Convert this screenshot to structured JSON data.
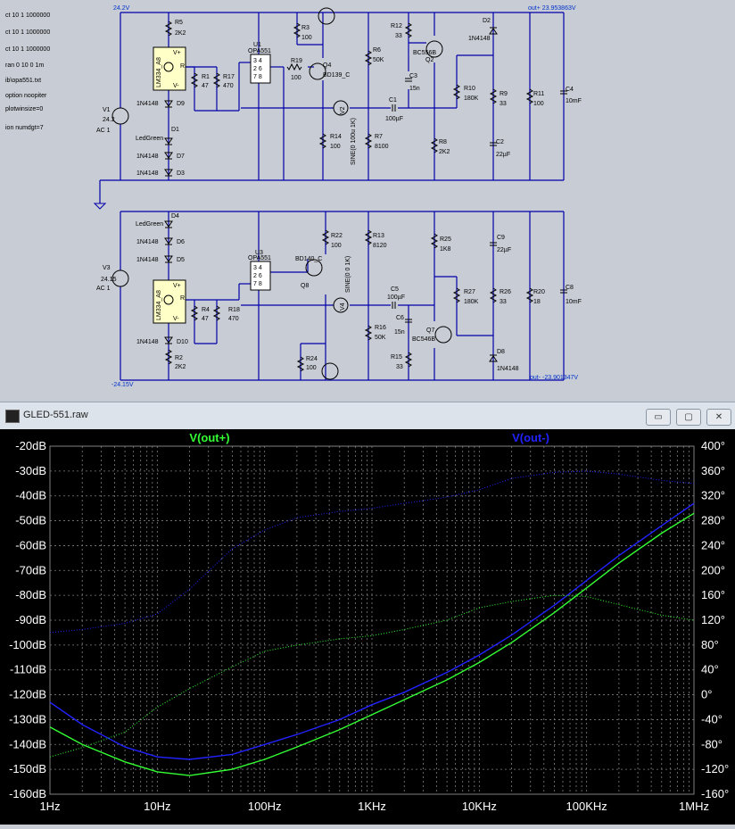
{
  "schematic": {
    "directives": [
      "ct 10 1 1000000",
      "ct 10 1 1000000",
      "ct 10 1 1000000",
      "ran 0 10 0 1m",
      "ib\\opa551.txt",
      "option noopiter",
      "plotwinsize=0",
      "ion numdgt=7"
    ],
    "net_top_left": "24.2V",
    "net_top_right": "out+ 23.953863V",
    "net_bottom_left": "-24.15V",
    "net_bottom_right": "out- -23.901347V",
    "parts": {
      "r5": "R5",
      "r5v": "2K2",
      "u_top": "LM334_A8",
      "vplus": "V+",
      "vminus": "V-",
      "rpin": "R",
      "r1": "R1",
      "r1v": "47",
      "r17": "R17",
      "r17v": "470",
      "d9": "D9",
      "dtype": "1N4148",
      "d1": "D1",
      "ledgreen": "LedGreen",
      "d7": "D7",
      "d3": "D3",
      "v1": "V1",
      "v1v": "24.2",
      "ac1": "AC 1",
      "u1": "U1",
      "opa": "OPA551",
      "pins1": "3 4",
      "pins2": "2 6",
      "pins3": "7 8",
      "r3": "R3",
      "r3v": "100",
      "r19": "R19",
      "r19v": "100",
      "q4": "Q4",
      "q4t": "BD139_C",
      "r6": "R6",
      "r6v": "50K",
      "r12": "R12",
      "r12v": "33",
      "c3": "C3",
      "c3v": "15n",
      "q2t": "BC556B",
      "q2": "Q2",
      "d2": "D2",
      "v2": "V2",
      "c1": "C1",
      "c1v": "100µF",
      "r14": "R14",
      "r14v": "100",
      "sine_top": "SINE(0 100u 1K)",
      "r7": "R7",
      "r7v": "8100",
      "r10": "R10",
      "r10v": "180K",
      "r8": "R8",
      "r8v": "2K2",
      "r9": "R9",
      "r9v": "33",
      "r11": "R11",
      "r11v": "100",
      "c2": "C2",
      "c2v": "22µF",
      "c4": "C4",
      "c4v": "10mF",
      "d4": "D4",
      "d6": "D6",
      "d5": "D5",
      "v3": "V3",
      "v3v": "24.15",
      "u3": "U3",
      "r22": "R22",
      "r22v": "100",
      "q8t": "BD140_C",
      "q8": "Q8",
      "r13": "R13",
      "r13v": "8120",
      "r25": "R25",
      "r25v": "1K8",
      "c9": "C9",
      "c9v": "22µF",
      "sine_bot": "SINE(0 0 1K)",
      "c5": "C5",
      "c5v": "100µF",
      "r27": "R27",
      "r27v": "180K",
      "r26": "R26",
      "r26v": "33",
      "r20": "R20",
      "r20v": "18",
      "c8": "C8",
      "c8v": "10mF",
      "r4": "R4",
      "r4v": "47",
      "r18": "R18",
      "r18v": "470",
      "d10": "D10",
      "r2": "R2",
      "r2v": "2K2",
      "r24": "R24",
      "r24v": "100",
      "v4": "V4",
      "r16": "R16",
      "r16v": "50K",
      "c6": "C6",
      "c6v": "15n",
      "q7": "Q7",
      "q7t": "BC546B",
      "r15": "R15",
      "r15v": "33",
      "d8": "D8"
    }
  },
  "window": {
    "title": "GLED-551.raw",
    "minimize": "▭",
    "maximize": "▢",
    "close": "✕"
  },
  "chart_data": {
    "type": "line",
    "title": "",
    "x_scale": "log",
    "xlim": [
      1,
      1000000
    ],
    "ylim": [
      -160,
      -20
    ],
    "y2lim": [
      -160,
      400
    ],
    "x_ticks": [
      "1Hz",
      "10Hz",
      "100Hz",
      "1KHz",
      "10KHz",
      "100KHz",
      "1MHz"
    ],
    "y_ticks": [
      "-20dB",
      "-30dB",
      "-40dB",
      "-50dB",
      "-60dB",
      "-70dB",
      "-80dB",
      "-90dB",
      "-100dB",
      "-110dB",
      "-120dB",
      "-130dB",
      "-140dB",
      "-150dB",
      "-160dB"
    ],
    "y2_ticks": [
      "400°",
      "360°",
      "320°",
      "280°",
      "240°",
      "200°",
      "160°",
      "120°",
      "80°",
      "40°",
      "0°",
      "-40°",
      "-80°",
      "-120°",
      "-160°"
    ],
    "grid": true,
    "colors": {
      "background": "#000000",
      "grid": "#808080",
      "green": "#33ff33",
      "blue": "#2222ff",
      "axis_text": "#ffffff"
    },
    "series": [
      {
        "name": "V(out+)",
        "kind": "magnitude",
        "color": "#33ff33",
        "x": [
          1,
          2,
          5,
          10,
          20,
          50,
          100,
          200,
          500,
          1000,
          2000,
          5000,
          10000,
          20000,
          50000,
          100000,
          200000,
          500000,
          1000000
        ],
        "y": [
          -133,
          -140,
          -147,
          -151,
          -152.5,
          -150,
          -146,
          -141,
          -134,
          -128,
          -122,
          -114,
          -107,
          -99,
          -87,
          -77,
          -67,
          -55,
          -47
        ]
      },
      {
        "name": "V(out-)",
        "kind": "magnitude",
        "color": "#2222ff",
        "x": [
          1,
          2,
          5,
          10,
          20,
          50,
          100,
          200,
          500,
          1000,
          2000,
          5000,
          10000,
          20000,
          50000,
          100000,
          200000,
          500000,
          1000000
        ],
        "y": [
          -123,
          -132,
          -141,
          -145,
          -146,
          -144,
          -140,
          -136,
          -130,
          -124,
          -119,
          -111,
          -104,
          -96,
          -84,
          -74,
          -64,
          -52,
          -43
        ]
      },
      {
        "name": "V(out+) phase",
        "kind": "phase",
        "color": "#33ff33",
        "x": [
          1,
          2,
          5,
          10,
          20,
          50,
          100,
          200,
          500,
          1000,
          2000,
          5000,
          10000,
          20000,
          50000,
          100000,
          200000,
          500000,
          1000000
        ],
        "y": [
          -100,
          -85,
          -60,
          -20,
          10,
          45,
          70,
          80,
          90,
          95,
          105,
          120,
          140,
          150,
          160,
          158,
          145,
          128,
          120
        ]
      },
      {
        "name": "V(out-) phase",
        "kind": "phase",
        "color": "#2222ff",
        "x": [
          1,
          2,
          5,
          10,
          20,
          50,
          100,
          200,
          500,
          1000,
          2000,
          5000,
          10000,
          20000,
          50000,
          100000,
          200000,
          500000,
          1000000
        ],
        "y": [
          100,
          105,
          115,
          130,
          170,
          235,
          265,
          285,
          295,
          300,
          308,
          318,
          330,
          348,
          358,
          360,
          355,
          345,
          340
        ]
      }
    ]
  }
}
